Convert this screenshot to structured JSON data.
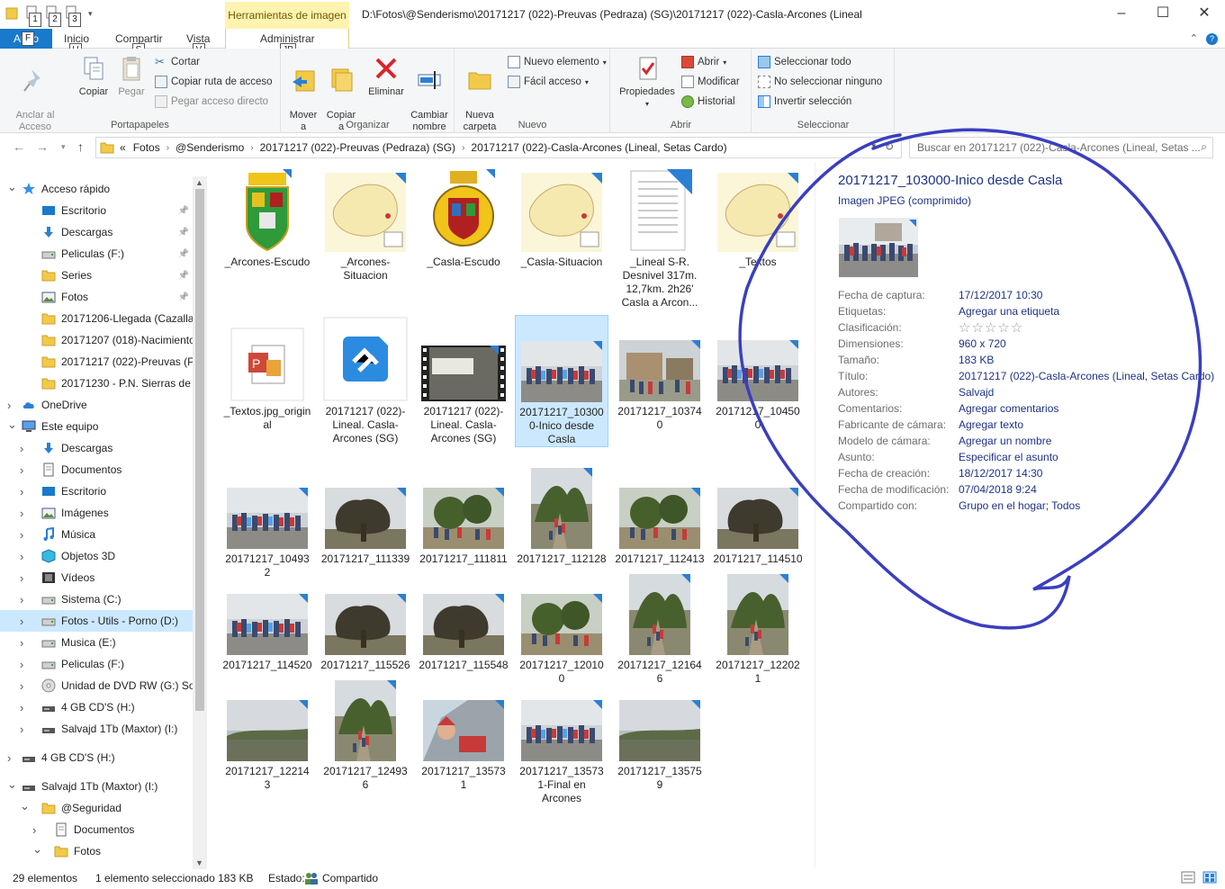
{
  "window": {
    "context_tab": "Herramientas de imagen",
    "title_path": "D:\\Fotos\\@Senderismo\\20171217 (022)-Preuvas (Pedraza) (SG)\\20171217 (022)-Casla-Arcones (Lineal",
    "qat_keys": [
      "1",
      "2",
      "3"
    ]
  },
  "tabs": [
    {
      "label": "Ar  vo",
      "key": "F"
    },
    {
      "label": "Inicio",
      "key": "H"
    },
    {
      "label": "Compartir",
      "key": "S"
    },
    {
      "label": "Vista",
      "key": "V"
    },
    {
      "label": "Administrar",
      "key": "JP"
    }
  ],
  "ribbon": {
    "portapapeles": {
      "label": "Portapapeles",
      "anclar": "Anclar al\nAcceso rápido",
      "copiar": "Copiar",
      "pegar": "Pegar",
      "cortar": "Cortar",
      "copiar_ruta": "Copiar ruta de acceso",
      "pegar_acceso": "Pegar acceso directo"
    },
    "organizar": {
      "label": "Organizar",
      "mover": "Mover\na",
      "copiar_a": "Copiar\na",
      "eliminar": "Eliminar",
      "cambiar": "Cambiar\nnombre"
    },
    "nuevo": {
      "label": "Nuevo",
      "nueva_carpeta": "Nueva\ncarpeta",
      "nuevo_elemento": "Nuevo elemento",
      "facil_acceso": "Fácil acceso"
    },
    "abrir": {
      "label": "Abrir",
      "propiedades": "Propiedades",
      "abrir": "Abrir",
      "modificar": "Modificar",
      "historial": "Historial"
    },
    "seleccionar": {
      "label": "Seleccionar",
      "todo": "Seleccionar todo",
      "ninguno": "No seleccionar ninguno",
      "invertir": "Invertir selección"
    }
  },
  "address": {
    "crumbs": [
      "Fotos",
      "@Senderismo",
      "20171217 (022)-Preuvas (Pedraza) (SG)",
      "20171217 (022)-Casla-Arcones (Lineal, Setas Cardo)"
    ],
    "prefix": "«",
    "search_placeholder": "Buscar en 20171217 (022)-Casla-Arcones (Lineal, Setas ..."
  },
  "sidebar": [
    {
      "label": "Acceso rápido",
      "level": 0,
      "icon": "star",
      "expanded": true
    },
    {
      "label": "Escritorio",
      "level": 1,
      "icon": "desktop",
      "pin": true
    },
    {
      "label": "Descargas",
      "level": 1,
      "icon": "download",
      "pin": true
    },
    {
      "label": "Peliculas (F:)",
      "level": 1,
      "icon": "drive",
      "pin": true
    },
    {
      "label": "Series",
      "level": 1,
      "icon": "folder",
      "pin": true
    },
    {
      "label": "Fotos",
      "level": 1,
      "icon": "pictures",
      "pin": true
    },
    {
      "label": "20171206-Llegada (Cazalla y C",
      "level": 1,
      "icon": "folder"
    },
    {
      "label": "20171207 (018)-Nacimiento Ri",
      "level": 1,
      "icon": "folder"
    },
    {
      "label": "20171217 (022)-Preuvas (Pedra",
      "level": 1,
      "icon": "folder"
    },
    {
      "label": "20171230 - P.N. Sierras de Caz",
      "level": 1,
      "icon": "folder"
    },
    {
      "label": "OneDrive",
      "level": 0,
      "icon": "cloud",
      "expanded": false
    },
    {
      "label": "Este equipo",
      "level": 0,
      "icon": "computer",
      "expanded": true
    },
    {
      "label": "Descargas",
      "level": 1,
      "icon": "download",
      "child": true
    },
    {
      "label": "Documentos",
      "level": 1,
      "icon": "documents",
      "child": true
    },
    {
      "label": "Escritorio",
      "level": 1,
      "icon": "desktop",
      "child": true
    },
    {
      "label": "Imágenes",
      "level": 1,
      "icon": "pictures",
      "child": true
    },
    {
      "label": "Música",
      "level": 1,
      "icon": "music",
      "child": true
    },
    {
      "label": "Objetos 3D",
      "level": 1,
      "icon": "cube",
      "child": true
    },
    {
      "label": "Vídeos",
      "level": 1,
      "icon": "video",
      "child": true
    },
    {
      "label": "Sistema (C:)",
      "level": 1,
      "icon": "drive",
      "child": true
    },
    {
      "label": "Fotos - Utils - Porno (D:)",
      "level": 1,
      "icon": "drive",
      "child": true,
      "selected": true
    },
    {
      "label": "Musica (E:)",
      "level": 1,
      "icon": "drive",
      "child": true
    },
    {
      "label": "Peliculas (F:)",
      "level": 1,
      "icon": "drive",
      "child": true
    },
    {
      "label": "Unidad de DVD RW (G:) Somos",
      "level": 1,
      "icon": "dvd",
      "child": true
    },
    {
      "label": "4 GB CD'S (H:)",
      "level": 1,
      "icon": "usb",
      "child": true
    },
    {
      "label": "Salvajd 1Tb (Maxtor) (I:)",
      "level": 1,
      "icon": "usb",
      "child": true
    },
    {
      "label": "4 GB CD'S (H:)",
      "level": 0,
      "icon": "usb",
      "expanded": false,
      "gap": true
    },
    {
      "label": "Salvajd 1Tb (Maxtor) (I:)",
      "level": 0,
      "icon": "usb",
      "expanded": true,
      "gap": true
    },
    {
      "label": "@Seguridad",
      "level": 1,
      "icon": "folder",
      "expanded": true
    },
    {
      "label": "Documentos",
      "level": 2,
      "icon": "documents",
      "child": true
    },
    {
      "label": "Fotos",
      "level": 2,
      "icon": "folder",
      "expanded": true
    }
  ],
  "files": [
    {
      "name": "_Arcones-Escudo",
      "kind": "shield-green"
    },
    {
      "name": "_Arcones-Situacion",
      "kind": "map"
    },
    {
      "name": "_Casla-Escudo",
      "kind": "shield-yellow"
    },
    {
      "name": "_Casla-Situacion",
      "kind": "map"
    },
    {
      "name": "_Lineal S-R. Desnivel 317m. 12,7km. 2h26' Casla a Arcon...",
      "kind": "doc"
    },
    {
      "name": "_Textos",
      "kind": "map"
    },
    {
      "name": "_Textos.jpg_original",
      "kind": "office"
    },
    {
      "name": "20171217 (022)-Lineal. Casla-Arcones (SG)",
      "kind": "gps"
    },
    {
      "name": "20171217 (022)-Lineal. Casla-Arcones (SG)",
      "kind": "video"
    },
    {
      "name": "20171217_103000-Inico desde Casla",
      "kind": "group",
      "selected": true
    },
    {
      "name": "20171217_103740",
      "kind": "village"
    },
    {
      "name": "20171217_104500",
      "kind": "group"
    },
    {
      "name": "20171217_104932",
      "kind": "group"
    },
    {
      "name": "20171217_111339",
      "kind": "trees"
    },
    {
      "name": "20171217_111811",
      "kind": "forest"
    },
    {
      "name": "20171217_112128",
      "kind": "tall"
    },
    {
      "name": "20171217_112413",
      "kind": "forest"
    },
    {
      "name": "20171217_114510",
      "kind": "trees"
    },
    {
      "name": "20171217_114520",
      "kind": "group"
    },
    {
      "name": "20171217_115526",
      "kind": "trees"
    },
    {
      "name": "20171217_115548",
      "kind": "trees"
    },
    {
      "name": "20171217_120100",
      "kind": "forest"
    },
    {
      "name": "20171217_121646",
      "kind": "tall"
    },
    {
      "name": "20171217_122021",
      "kind": "tall"
    },
    {
      "name": "20171217_122143",
      "kind": "sky"
    },
    {
      "name": "20171217_124936",
      "kind": "tall"
    },
    {
      "name": "20171217_135731",
      "kind": "selfie"
    },
    {
      "name": "20171217_135731-Final en Arcones",
      "kind": "group"
    },
    {
      "name": "20171217_135759",
      "kind": "sky"
    }
  ],
  "details": {
    "title": "20171217_103000-Inico desde Casla",
    "type": "Imagen JPEG (comprimido)",
    "props": [
      {
        "k": "Fecha de captura:",
        "v": "17/12/2017 10:30"
      },
      {
        "k": "Etiquetas:",
        "v": "Agregar una etiqueta"
      },
      {
        "k": "Clasificación:",
        "v": "☆☆☆☆☆"
      },
      {
        "k": "Dimensiones:",
        "v": "960 x 720"
      },
      {
        "k": "Tamaño:",
        "v": "183 KB"
      },
      {
        "k": "Título:",
        "v": "20171217 (022)-Casla-Arcones (Lineal, Setas Cardo)"
      },
      {
        "k": "Autores:",
        "v": "Salvajd"
      },
      {
        "k": "Comentarios:",
        "v": "Agregar comentarios"
      },
      {
        "k": "Fabricante de cámara:",
        "v": "Agregar texto"
      },
      {
        "k": "Modelo de cámara:",
        "v": "Agregar un nombre"
      },
      {
        "k": "Asunto:",
        "v": "Especificar el asunto"
      },
      {
        "k": "Fecha de creación:",
        "v": "18/12/2017 14:30"
      },
      {
        "k": "Fecha de modificación:",
        "v": "07/04/2018 9:24"
      },
      {
        "k": "Compartido con:",
        "v": "Grupo en el hogar; Todos"
      }
    ]
  },
  "status": {
    "count": "29 elementos",
    "selection": "1 elemento seleccionado  183 KB",
    "state_label": "Estado:",
    "state_value": "Compartido"
  },
  "colors": {
    "accent": "#1979ca",
    "selection": "#cce8ff",
    "link": "#1e3287",
    "annotation": "#3a3fbf",
    "context_tab": "#fff3b0"
  }
}
